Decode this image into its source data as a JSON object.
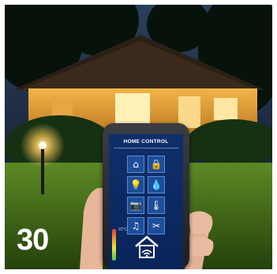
{
  "badge": {
    "number": "30"
  },
  "phone": {
    "title": "HOME CONTROL",
    "temperature": "22°C",
    "tiles": [
      {
        "icon": "house-icon",
        "glyph": "⌂"
      },
      {
        "icon": "lock-icon",
        "glyph": "🔒"
      },
      {
        "icon": "bulb-icon",
        "glyph": "💡"
      },
      {
        "icon": "water-drop-icon",
        "glyph": "💧"
      },
      {
        "icon": "camera-icon",
        "glyph": "📷"
      },
      {
        "icon": "thermometer-icon",
        "glyph": "🌡"
      },
      {
        "icon": "music-icon",
        "glyph": "♫"
      },
      {
        "icon": "tools-icon",
        "glyph": "✂"
      }
    ]
  },
  "colors": {
    "sky": "#0d1b2c",
    "house_glow": "#f2b547",
    "lawn": "#4f7a1e",
    "screen": "#0f2f6b",
    "tile": "#1d4e9a"
  }
}
